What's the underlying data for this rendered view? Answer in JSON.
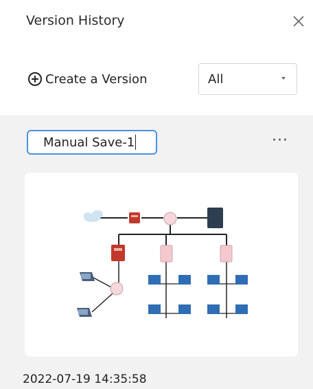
{
  "panel": {
    "title": "Version History",
    "close_icon": "close-icon"
  },
  "toolbar": {
    "create_label": "Create a Version",
    "create_icon": "plus-circle-icon",
    "filter": {
      "selected": "All",
      "icon": "chevron-down-icon"
    }
  },
  "version": {
    "name_value": "Manual Save-1",
    "more_label": "···",
    "timestamp": "2022-07-19 14:35:58"
  },
  "colors": {
    "accent": "#4a90e2",
    "panel_bg": "#f2f2f2",
    "card_bg": "#ffffff"
  }
}
